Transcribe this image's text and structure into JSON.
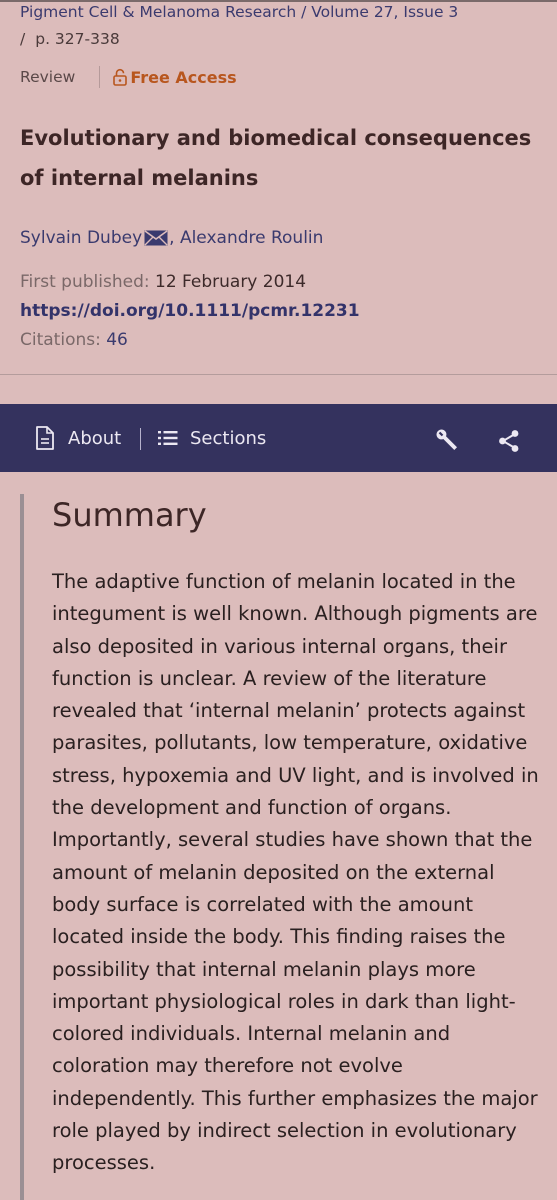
{
  "header": {
    "journal": "Pigment Cell & Melanoma Research / Volume 27, Issue 3",
    "pages_slash": "/",
    "pages": "p. 327-338"
  },
  "article": {
    "type": "Review",
    "access": "Free Access",
    "title": "Evolutionary and biomedical consequences of internal melanins",
    "author_1": "Sylvain Dubey",
    "author_sep": ", ",
    "author_2": "Alexandre Roulin",
    "first_published_label": "First published:",
    "first_published_value": "12 February 2014",
    "doi": "https://doi.org/10.1111/pcmr.12231",
    "citations_label": "Citations:",
    "citations_value": "46"
  },
  "navbar": {
    "about_label": "About",
    "sections_label": "Sections",
    "tools_icon": "wrench-icon",
    "share_icon": "share-icon"
  },
  "summary": {
    "heading": "Summary",
    "text": "The adaptive function of melanin located in the integument is well known. Although pigments are also deposited in various internal organs, their function is unclear. A review of the literature revealed that ‘internal melanin’ protects against parasites, pollutants, low temperature, oxidative stress, hypoxemia and UV light, and is involved in the development and function of organs. Importantly, several studies have shown that the amount of melanin deposited on the external body surface is correlated with the amount located inside the body. This finding raises the possibility that internal melanin plays more important physiological roles in dark than light-colored individuals. Internal melanin and coloration may therefore not evolve independently. This further emphasizes the major role played by indirect selection in evolutionary processes."
  },
  "colors": {
    "background": "#dcbcbb",
    "navbar": "#34325e",
    "link": "#3a3a6e",
    "free_access": "#b8561e"
  }
}
